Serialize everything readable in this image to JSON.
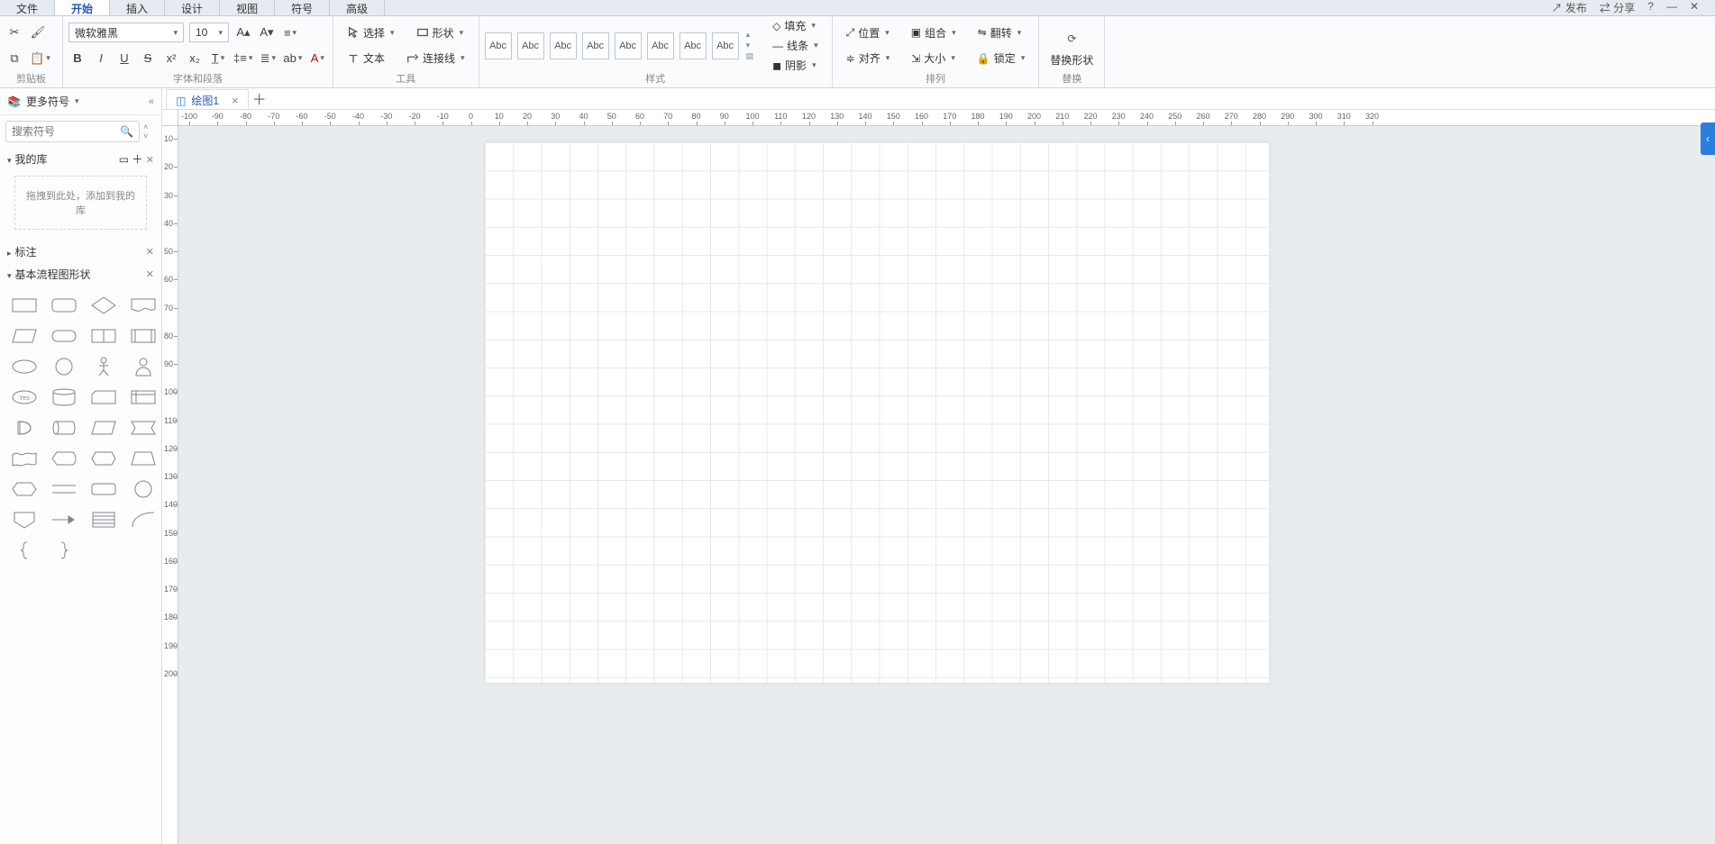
{
  "menu": {
    "tabs": [
      "文件",
      "开始",
      "插入",
      "设计",
      "视图",
      "符号",
      "高级"
    ],
    "active": 1,
    "right": [
      "发布",
      "分享",
      "?"
    ]
  },
  "ribbon": {
    "clipboard": {
      "title": "剪贴板"
    },
    "font": {
      "title": "字体和段落",
      "family": "微软雅黑",
      "size": "10"
    },
    "tools": {
      "title": "工具",
      "select": "选择",
      "shape": "形状",
      "text": "文本",
      "connector": "连接线"
    },
    "styles": {
      "title": "样式",
      "abc": "Abc",
      "fill": "填充",
      "line": "线条",
      "shadow": "阴影"
    },
    "arrange": {
      "title": "排列",
      "position": "位置",
      "group": "组合",
      "flip": "翻转",
      "align": "对齐",
      "size": "大小",
      "lock": "锁定"
    },
    "replace": {
      "title": "替换",
      "label": "替换形状"
    }
  },
  "sidebar": {
    "header": "更多符号",
    "search_ph": "搜索符号",
    "mylib": "我的库",
    "dropzone": "拖拽到此处，添加到我的库",
    "annot": "标注",
    "basic": "基本流程图形状"
  },
  "tabs": {
    "doc": "绘图1"
  },
  "ruler": {
    "h": [
      "-100",
      "-90",
      "-80",
      "-70",
      "-60",
      "-50",
      "-40",
      "-30",
      "-20",
      "-10",
      "0",
      "10",
      "20",
      "30",
      "40",
      "50",
      "60",
      "70",
      "80",
      "90",
      "100",
      "110",
      "120",
      "130",
      "140",
      "150",
      "160",
      "170",
      "180",
      "190",
      "200",
      "210",
      "220",
      "230",
      "240",
      "250",
      "260",
      "270",
      "280",
      "290",
      "300",
      "310",
      "320"
    ],
    "v": [
      "10",
      "20",
      "30",
      "40",
      "50",
      "60",
      "70",
      "80",
      "90",
      "100",
      "110",
      "120",
      "130",
      "140",
      "150",
      "160",
      "170",
      "180",
      "190",
      "200"
    ]
  }
}
